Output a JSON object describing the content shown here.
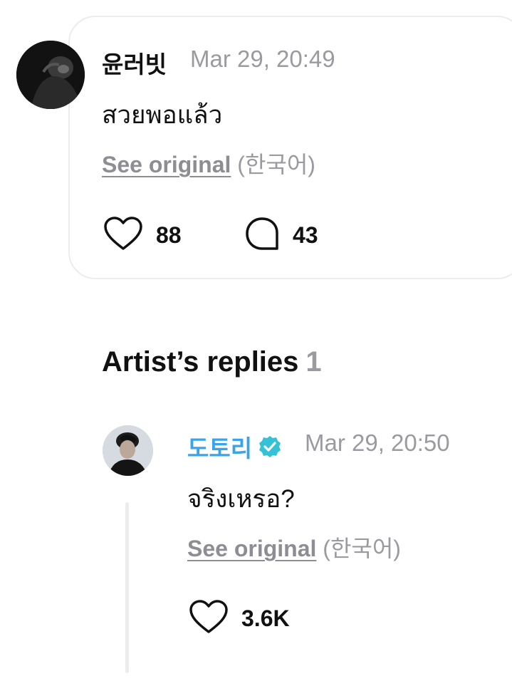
{
  "comment": {
    "author": "윤러빗",
    "timestamp": "Mar 29, 20:49",
    "text": "สวยพอแล้ว",
    "see_original_link": "See original",
    "see_original_lang": "(한국어)",
    "likes": "88",
    "replies": "43"
  },
  "section": {
    "title": "Artist’s replies",
    "count": "1"
  },
  "reply": {
    "author": "도토리",
    "timestamp": "Mar 29, 20:50",
    "text": "จริงเหรอ?",
    "see_original_link": "See original",
    "see_original_lang": "(한국어)",
    "likes": "3.6K"
  },
  "colors": {
    "artist_name": "#3aa4ea",
    "muted": "#9a9aa0",
    "card_border": "#ececef"
  },
  "icons": [
    "heart-icon",
    "comment-bubble-icon",
    "verified-badge-icon"
  ]
}
